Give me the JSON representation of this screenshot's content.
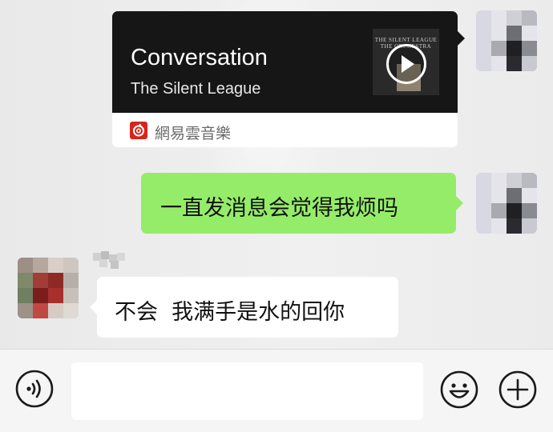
{
  "conversation": {
    "music_card": {
      "title": "Conversation",
      "artist": "The Silent League",
      "album_cover_text": "THE SILENT LEAGUE\nTHE ORCHESTRA",
      "source_name": "網易雲音樂",
      "source_icon": "netease-cloud-music-icon",
      "card_color": "#161616",
      "source_color": "#d7251c"
    },
    "sent_message": {
      "text": "一直发消息会觉得我烦吗",
      "bubble_color": "#95ec69"
    },
    "received_message": {
      "text": "不会  我满手是水的回你",
      "bubble_color": "#ffffff"
    }
  },
  "input_bar": {
    "voice_icon": "voice-icon",
    "emoji_icon": "emoji-icon",
    "plus_icon": "plus-icon",
    "text_value": ""
  }
}
